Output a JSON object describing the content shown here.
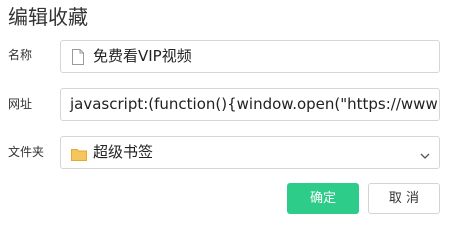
{
  "dialog": {
    "title": "编辑收藏",
    "name_label": "名称",
    "name_value": "免费看VIP视频",
    "url_label": "网址",
    "url_value": "javascript:(function(){window.open(\"https://www",
    "folder_label": "文件夹",
    "folder_value": "超级书签",
    "ok_label": "确定",
    "cancel_label": "取 消"
  },
  "icons": {
    "name_field_icon": "page-icon",
    "folder_field_icon": "folder-icon",
    "folder_dropdown_icon": "chevron-down-icon"
  },
  "colors": {
    "primary_button": "#2ecc89",
    "folder_icon": "#f5c65b"
  }
}
